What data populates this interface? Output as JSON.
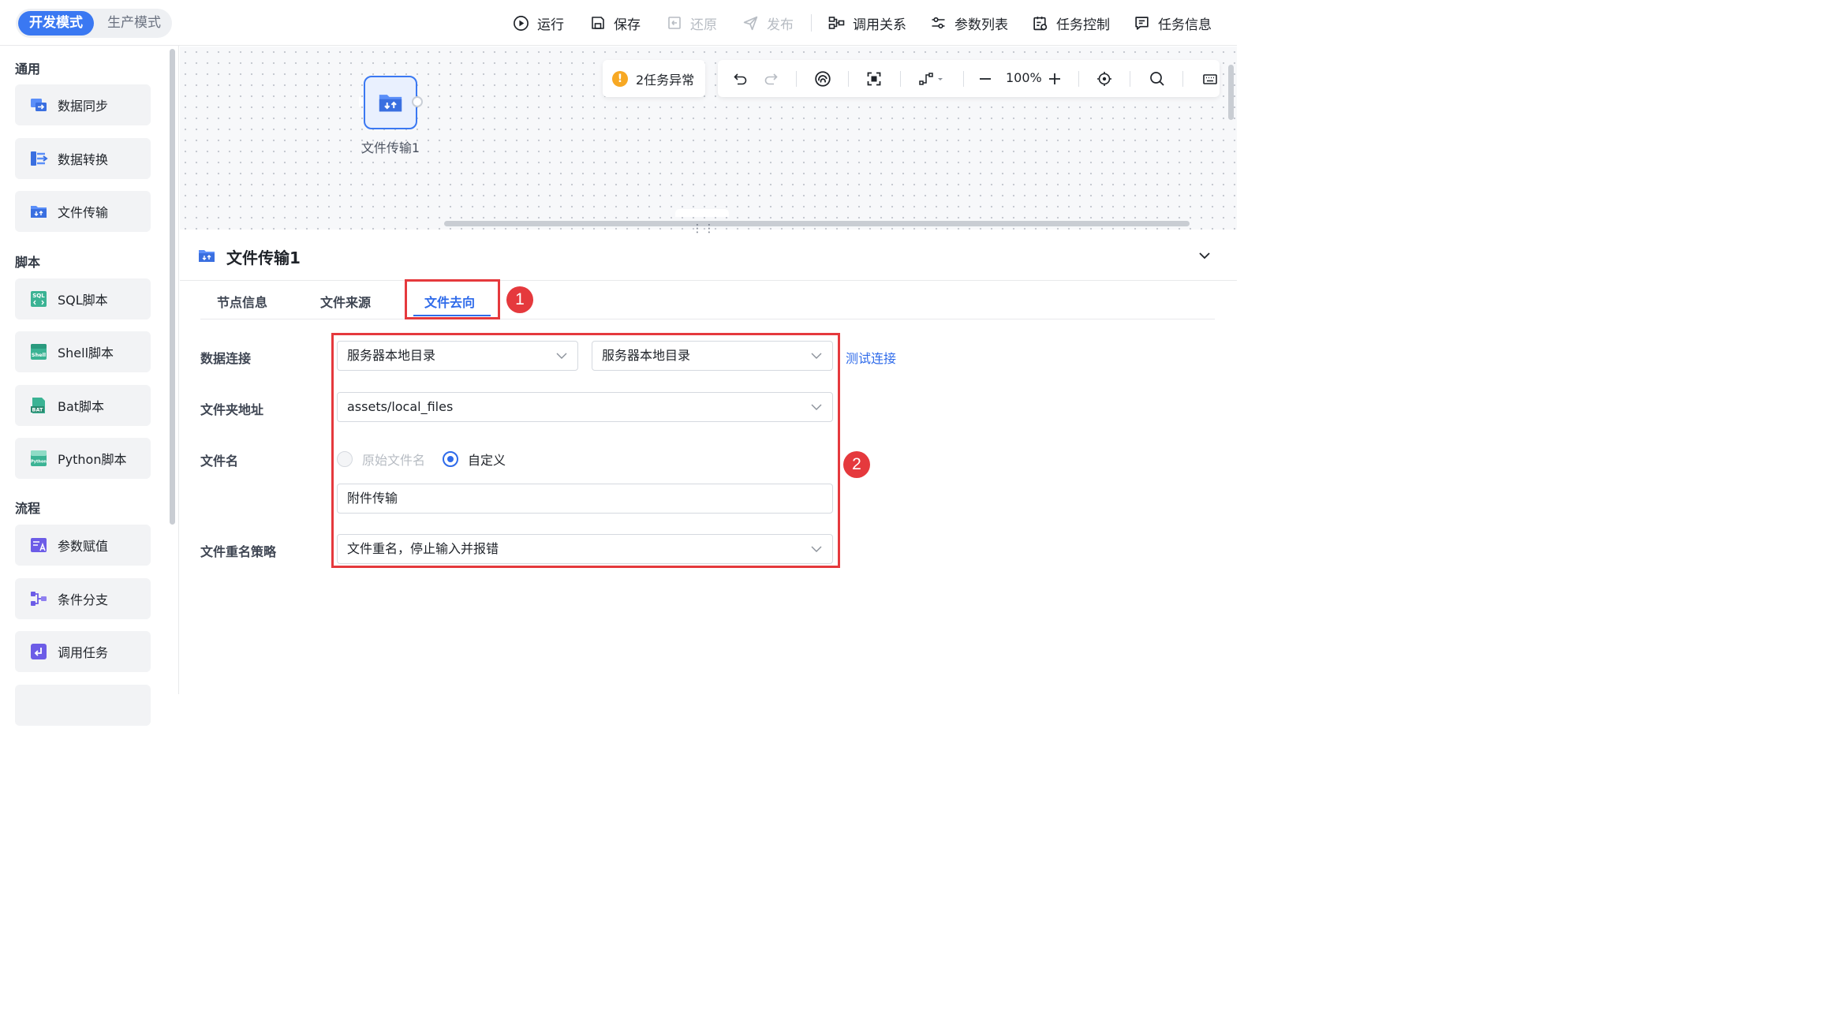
{
  "topbar": {
    "modes": {
      "dev": "开发模式",
      "prod": "生产模式"
    },
    "tools": {
      "run": "运行",
      "save": "保存",
      "restore": "还原",
      "publish": "发布",
      "call_relation": "调用关系",
      "param_list": "参数列表",
      "task_control": "任务控制",
      "task_info": "任务信息"
    }
  },
  "sidebar": {
    "groups": {
      "general": {
        "title": "通用",
        "items": [
          "数据同步",
          "数据转换",
          "文件传输"
        ]
      },
      "script": {
        "title": "脚本",
        "items": [
          "SQL脚本",
          "Shell脚本",
          "Bat脚本",
          "Python脚本"
        ]
      },
      "flow": {
        "title": "流程",
        "items": [
          "参数赋值",
          "条件分支",
          "调用任务"
        ]
      }
    },
    "icon_text": {
      "sql": "SQL",
      "shell": "Shell",
      "bat": "BAT",
      "python": "Python"
    }
  },
  "canvas": {
    "node_label": "文件传输1",
    "warning": "2任务异常",
    "zoom": "100%",
    "resize_grip": "⋮⋮"
  },
  "panel": {
    "title": "文件传输1",
    "tabs": [
      "节点信息",
      "文件来源",
      "文件去向"
    ],
    "active_tab": "文件去向",
    "fields": {
      "data_connection": {
        "label": "数据连接",
        "value1": "服务器本地目录",
        "value2": "服务器本地目录",
        "test_link": "测试连接"
      },
      "folder": {
        "label": "文件夹地址",
        "value": "assets/local_files"
      },
      "filename": {
        "label": "文件名",
        "options": [
          "原始文件名",
          "自定义"
        ],
        "selected": "自定义",
        "value": "附件传输"
      },
      "rename_policy": {
        "label": "文件重名策略",
        "value": "文件重名，停止输入并报错"
      }
    }
  },
  "annotations": {
    "one": "1",
    "two": "2"
  },
  "colors": {
    "accent": "#3a78f2",
    "annotation": "#e5393d",
    "warning": "#f7a823"
  }
}
